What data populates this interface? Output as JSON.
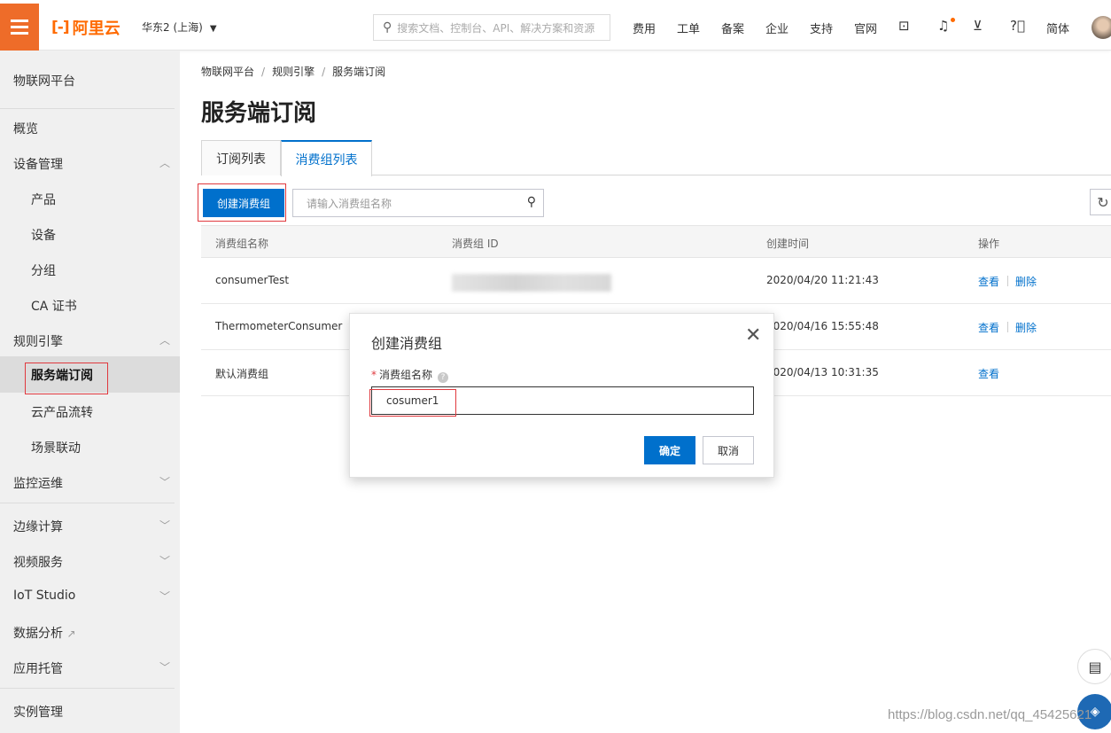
{
  "topbar": {
    "brand": "阿里云",
    "region": "华东2 (上海)",
    "search_placeholder": "搜索文档、控制台、API、解决方案和资源",
    "nav": [
      "费用",
      "工单",
      "备案",
      "企业",
      "支持",
      "官网"
    ],
    "lang": "简体",
    "accent_color": "#ff6a00"
  },
  "sidebar": {
    "title": "物联网平台",
    "items": {
      "overview": "概览",
      "device_mgmt": "设备管理",
      "product": "产品",
      "device": "设备",
      "group": "分组",
      "ca_cert": "CA 证书",
      "rule_engine": "规则引擎",
      "server_sub": "服务端订阅",
      "cloud_flow": "云产品流转",
      "scene_link": "场景联动",
      "monitor_ops": "监控运维",
      "edge_compute": "边缘计算",
      "video_service": "视频服务",
      "iot_studio": "IoT Studio",
      "data_analysis": "数据分析",
      "app_hosting": "应用托管",
      "instance_mgmt": "实例管理"
    }
  },
  "breadcrumb": [
    "物联网平台",
    "规则引擎",
    "服务端订阅"
  ],
  "page_title": "服务端订阅",
  "tabs": [
    "订阅列表",
    "消费组列表"
  ],
  "toolbar": {
    "create_label": "创建消费组",
    "search_placeholder": "请输入消费组名称"
  },
  "table": {
    "headers": [
      "消费组名称",
      "消费组 ID",
      "创建时间",
      "操作"
    ],
    "rows": [
      {
        "name": "consumerTest",
        "created": "2020/04/20 11:21:43",
        "actions": [
          "查看",
          "删除"
        ]
      },
      {
        "name": "ThermometerConsumer",
        "created": "2020/04/16 15:55:48",
        "actions": [
          "查看",
          "删除"
        ]
      },
      {
        "name": "默认消费组",
        "created": "2020/04/13 10:31:35",
        "actions": [
          "查看"
        ]
      }
    ]
  },
  "dialog": {
    "title": "创建消费组",
    "field_label": "消费组名称",
    "field_value": "cosumer1",
    "ok_label": "确定",
    "cancel_label": "取消"
  },
  "watermark": "https://blog.csdn.net/qq_45425621"
}
